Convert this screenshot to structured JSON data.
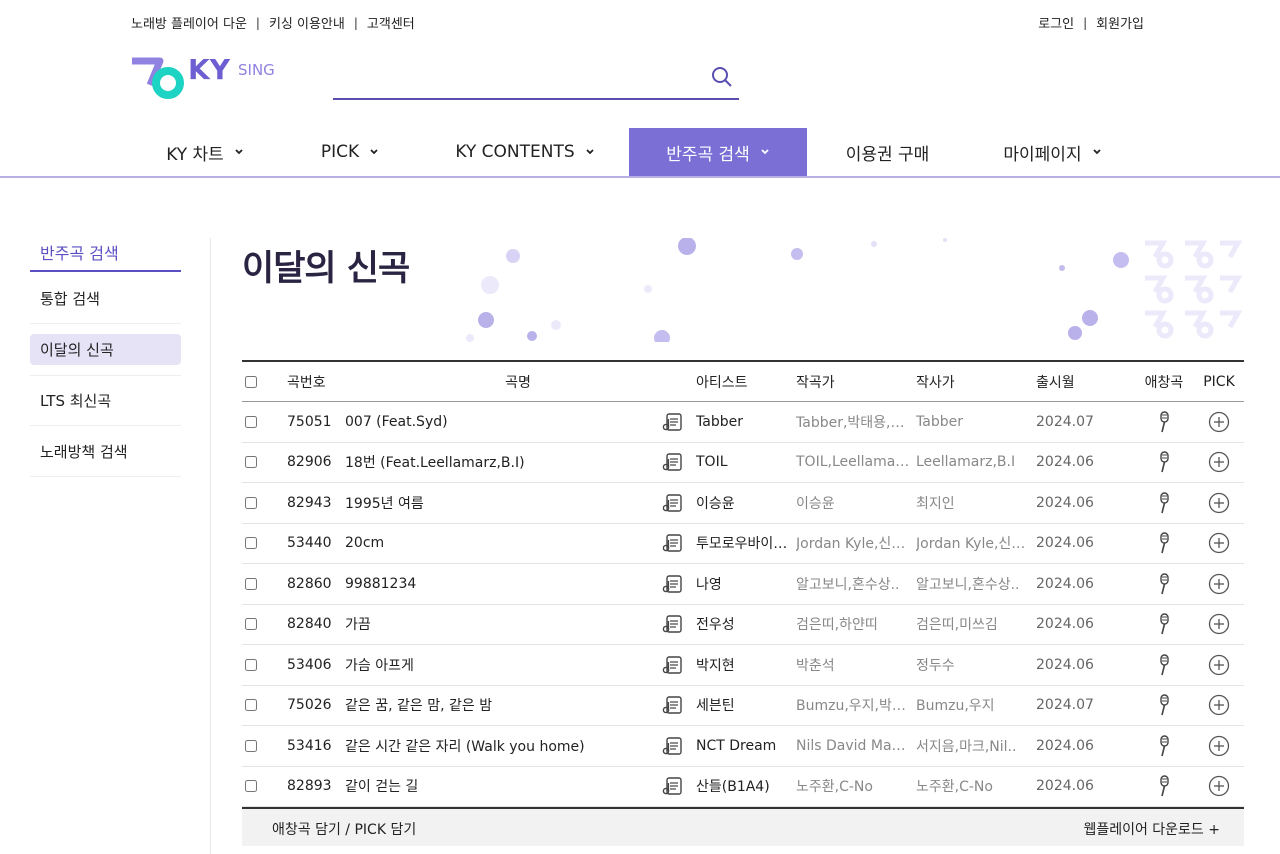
{
  "util": {
    "left": [
      "노래방 플레이어 다운",
      "키싱 이용안내",
      "고객센터"
    ],
    "sep": "|",
    "right": [
      "로그인",
      "회원가입"
    ]
  },
  "logo": {
    "text": "KY",
    "sub": "SING"
  },
  "search": {
    "value": "",
    "placeholder": ""
  },
  "gnb": [
    {
      "label": "KY 차트",
      "active": false
    },
    {
      "label": "PICK",
      "active": false
    },
    {
      "label": "KY CONTENTS",
      "active": false
    },
    {
      "label": "반주곡 검색",
      "active": true
    },
    {
      "label": "이용권 구매",
      "active": false
    },
    {
      "label": "마이페이지",
      "active": false
    }
  ],
  "sidebar": {
    "title": "반주곡 검색",
    "items": [
      "통합 검색",
      "이달의 신곡",
      "LTS 최신곡",
      "노래방책 검색"
    ],
    "active_index": 1
  },
  "page_title": "이달의 신곡",
  "table": {
    "headers": {
      "no": "곡번호",
      "title": "곡명",
      "artist": "아티스트",
      "composer": "작곡가",
      "lyricist": "작사가",
      "date": "출시월",
      "fav": "애창곡",
      "pick": "PICK"
    },
    "rows": [
      {
        "no": "75051",
        "title": "007 (Feat.Syd)",
        "artist": "Tabber",
        "composer": "Tabber,박태용,…",
        "lyricist": "Tabber",
        "date": "2024.07"
      },
      {
        "no": "82906",
        "title": "18번 (Feat.Leellamarz,B.I)",
        "artist": "TOIL",
        "composer": "TOIL,Leellama…",
        "lyricist": "Leellamarz,B.I",
        "date": "2024.06"
      },
      {
        "no": "82943",
        "title": "1995년 여름",
        "artist": "이승윤",
        "composer": "이승윤",
        "lyricist": "최지인",
        "date": "2024.06"
      },
      {
        "no": "53440",
        "title": "20cm",
        "artist": "투모로우바이…",
        "composer": "Jordan Kyle,신…",
        "lyricist": "Jordan Kyle,신…",
        "date": "2024.06"
      },
      {
        "no": "82860",
        "title": "99881234",
        "artist": "나영",
        "composer": "알고보니,혼수상..",
        "lyricist": "알고보니,혼수상..",
        "date": "2024.06"
      },
      {
        "no": "82840",
        "title": "가끔",
        "artist": "전우성",
        "composer": "검은띠,하얀띠",
        "lyricist": "검은띠,미쓰김",
        "date": "2024.06"
      },
      {
        "no": "53406",
        "title": "가슴 아프게",
        "artist": "박지현",
        "composer": "박춘석",
        "lyricist": "정두수",
        "date": "2024.06"
      },
      {
        "no": "75026",
        "title": "같은 꿈, 같은 맘, 같은 밤",
        "artist": "세븐틴",
        "composer": "Bumzu,우지,박…",
        "lyricist": "Bumzu,우지",
        "date": "2024.07"
      },
      {
        "no": "53416",
        "title": "같은 시간 같은 자리 (Walk you home)",
        "artist": "NCT Dream",
        "composer": "Nils David Matt..",
        "lyricist": "서지음,마크,Nil..",
        "date": "2024.06"
      },
      {
        "no": "82893",
        "title": "같이 걷는 길",
        "artist": "산들(B1A4)",
        "composer": "노주환,C-No",
        "lyricist": "노주환,C-No",
        "date": "2024.06"
      }
    ]
  },
  "footer": {
    "left": "애창곡 담기 / PICK 담기",
    "right": "웹플레이어 다운로드 +"
  },
  "colors": {
    "accent": "#7b6fd6",
    "accent_dark": "#5b4fc2",
    "logo_teal": "#1dd3c4"
  }
}
